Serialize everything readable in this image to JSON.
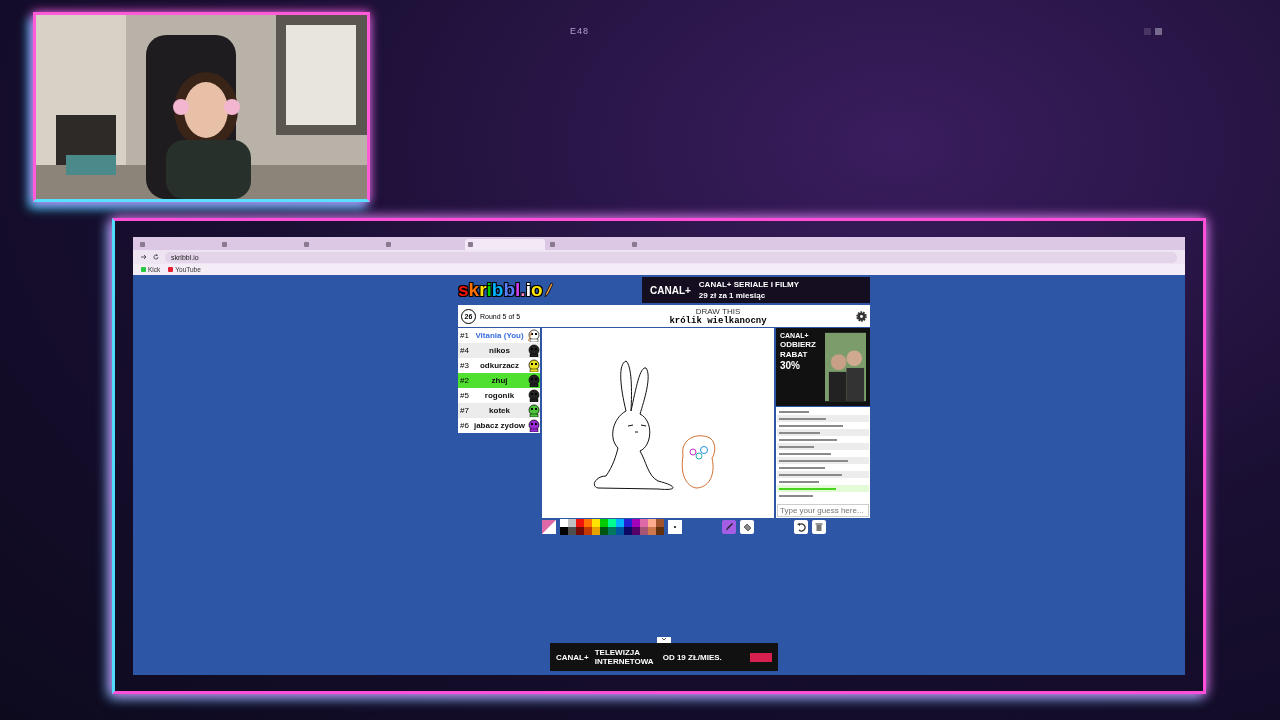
{
  "overlay": {
    "label": "E48"
  },
  "browser": {
    "tabs": [
      {
        "selected": false
      },
      {
        "selected": false
      },
      {
        "selected": false
      },
      {
        "selected": false
      },
      {
        "selected": true
      },
      {
        "selected": false
      },
      {
        "selected": false
      }
    ],
    "address": "skribbl.io",
    "bookmarks": [
      {
        "label": "Kick",
        "color": "#28c840"
      },
      {
        "label": "YouTube",
        "color": "#e01e2f"
      }
    ]
  },
  "game": {
    "logo": "skribbl.io",
    "timer": "26",
    "round": "Round 5 of 5",
    "hint_label": "DRAW THIS",
    "word": "królik wielkanocny",
    "players": [
      {
        "rank": "#1",
        "name": "Vitania (You)",
        "color": "#ffffff",
        "drawing": true,
        "guessed": false
      },
      {
        "rank": "#4",
        "name": "nikos",
        "color": "#222222",
        "drawing": false,
        "guessed": false
      },
      {
        "rank": "#3",
        "name": "odkurzacz",
        "color": "#e8e020",
        "drawing": false,
        "guessed": false
      },
      {
        "rank": "#2",
        "name": "zhuj",
        "color": "#222222",
        "drawing": false,
        "guessed": true
      },
      {
        "rank": "#5",
        "name": "rogonik",
        "color": "#222222",
        "drawing": false,
        "guessed": false
      },
      {
        "rank": "#7",
        "name": "kotek",
        "color": "#4cc43a",
        "drawing": false,
        "guessed": false
      },
      {
        "rank": "#6",
        "name": "jabacz zydow",
        "color": "#9a2ad8",
        "drawing": false,
        "guessed": false
      }
    ],
    "chat": [
      {
        "kind": "message"
      },
      {
        "kind": "message"
      },
      {
        "kind": "message"
      },
      {
        "kind": "message"
      },
      {
        "kind": "message"
      },
      {
        "kind": "message"
      },
      {
        "kind": "message"
      },
      {
        "kind": "message"
      },
      {
        "kind": "message"
      },
      {
        "kind": "message"
      },
      {
        "kind": "message"
      },
      {
        "kind": "guessed"
      },
      {
        "kind": "message"
      }
    ],
    "chat_placeholder": "Type your guess here...",
    "palette": [
      {
        "color": "#ffffff"
      },
      {
        "color": "#000000"
      },
      {
        "color": "#c1c1c1"
      },
      {
        "color": "#505050"
      },
      {
        "color": "#ef130b"
      },
      {
        "color": "#740b07"
      },
      {
        "color": "#ff7100"
      },
      {
        "color": "#c23800"
      },
      {
        "color": "#ffe400"
      },
      {
        "color": "#e8a200"
      },
      {
        "color": "#00cc00"
      },
      {
        "color": "#005510"
      },
      {
        "color": "#00ff91"
      },
      {
        "color": "#00785d"
      },
      {
        "color": "#00b2ff"
      },
      {
        "color": "#00569e"
      },
      {
        "color": "#231fd3"
      },
      {
        "color": "#0e0865"
      },
      {
        "color": "#a300ba"
      },
      {
        "color": "#550069"
      },
      {
        "color": "#df69a7"
      },
      {
        "color": "#a75574"
      },
      {
        "color": "#ffac8e"
      },
      {
        "color": "#cc774d"
      },
      {
        "color": "#a0522d"
      },
      {
        "color": "#63300d"
      }
    ],
    "tools": [
      {
        "kind": "pen",
        "selected": true
      },
      {
        "kind": "fill",
        "selected": false
      }
    ]
  },
  "ads": {
    "top": {
      "brand": "CANAL+",
      "headline": "CANAL+ SERIALE I FILMY",
      "price": "29 zł za 1 miesiąc"
    },
    "side": {
      "brand": "CANAL+",
      "lines": [
        "ODBIERZ",
        "RABAT"
      ],
      "discount": "30%"
    },
    "bottom": {
      "brand": "CANAL+",
      "headline": "TELEWIZJA INTERNETOWA",
      "price": "OD 19 ZŁ/MIES."
    }
  }
}
